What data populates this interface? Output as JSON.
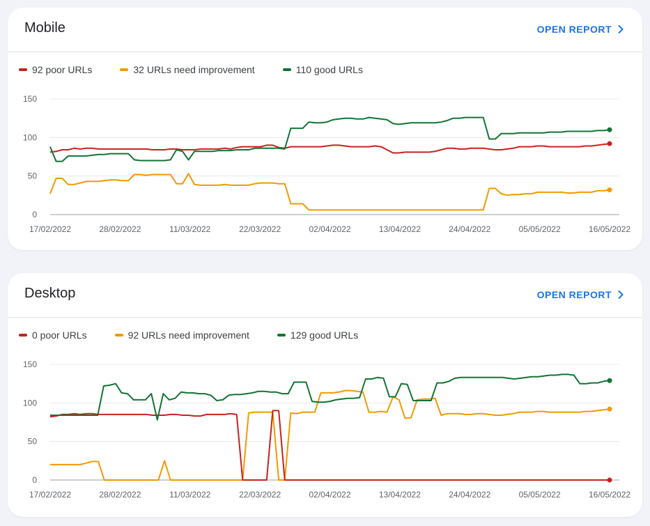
{
  "colors": {
    "poor": "#c5221f",
    "needs": "#f29900",
    "good": "#137333"
  },
  "cards": [
    {
      "title": "Mobile",
      "open_report_label": "OPEN REPORT",
      "legend": {
        "poor": "92 poor URLs",
        "needs": "32 URLs need improvement",
        "good": "110 good URLs"
      }
    },
    {
      "title": "Desktop",
      "open_report_label": "OPEN REPORT",
      "legend": {
        "poor": "0 poor URLs",
        "needs": "92 URLs need improvement",
        "good": "129 good URLs"
      }
    }
  ],
  "chart_data": [
    {
      "type": "line",
      "title": "",
      "y_ticks": [
        "150",
        "100",
        "50",
        "0"
      ],
      "ylim": [
        0,
        150
      ],
      "x_labels": [
        "17/02/2022",
        "28/02/2022",
        "11/03/2022",
        "22/03/2022",
        "02/04/2022",
        "13/04/2022",
        "24/04/2022",
        "05/05/2022",
        "16/05/2022"
      ],
      "x_start": "17/02/2022",
      "x_end": "16/05/2022",
      "series": [
        {
          "name": "92 poor URLs",
          "key": "poor",
          "values": [
            81,
            82,
            84,
            84,
            86,
            85,
            86,
            86,
            85,
            85,
            85,
            85,
            85,
            85,
            85,
            85,
            85,
            84,
            84,
            84,
            85,
            85,
            84,
            84,
            84,
            85,
            85,
            85,
            85,
            86,
            85,
            87,
            88,
            88,
            88,
            88,
            90,
            90,
            87,
            86,
            88,
            88,
            88,
            88,
            88,
            88,
            89,
            90,
            90,
            89,
            88,
            88,
            88,
            88,
            89,
            88,
            84,
            80,
            80,
            81,
            81,
            81,
            81,
            81,
            82,
            84,
            86,
            86,
            85,
            85,
            86,
            86,
            86,
            85,
            84,
            84,
            85,
            86,
            88,
            88,
            88,
            89,
            89,
            88,
            88,
            88,
            88,
            88,
            88,
            89,
            89,
            90,
            91,
            92
          ]
        },
        {
          "name": "32 URLs need improvement",
          "key": "needs",
          "values": [
            27,
            47,
            47,
            39,
            39,
            41,
            43,
            43,
            43,
            44,
            45,
            45,
            44,
            44,
            52,
            52,
            51,
            52,
            52,
            52,
            52,
            40,
            40,
            53,
            39,
            38,
            38,
            38,
            38,
            39,
            38,
            38,
            38,
            38,
            40,
            41,
            41,
            41,
            40,
            40,
            14,
            14,
            14,
            6,
            6,
            6,
            6,
            6,
            6,
            6,
            6,
            6,
            6,
            6,
            6,
            6,
            6,
            6,
            6,
            6,
            6,
            6,
            6,
            6,
            6,
            6,
            6,
            6,
            6,
            6,
            6,
            6,
            6,
            34,
            34,
            27,
            25,
            26,
            26,
            27,
            27,
            29,
            29,
            29,
            29,
            29,
            28,
            28,
            29,
            29,
            29,
            31,
            31,
            32
          ]
        },
        {
          "name": "110 good URLs",
          "key": "good",
          "values": [
            88,
            69,
            69,
            76,
            76,
            76,
            76,
            77,
            78,
            78,
            79,
            79,
            79,
            79,
            71,
            70,
            70,
            70,
            70,
            70,
            71,
            84,
            82,
            71,
            82,
            82,
            82,
            82,
            83,
            83,
            83,
            84,
            84,
            84,
            86,
            86,
            86,
            86,
            86,
            85,
            112,
            112,
            112,
            120,
            119,
            119,
            120,
            123,
            124,
            125,
            125,
            124,
            124,
            126,
            125,
            124,
            123,
            118,
            117,
            118,
            119,
            119,
            119,
            119,
            119,
            120,
            122,
            125,
            125,
            126,
            126,
            126,
            126,
            98,
            98,
            105,
            105,
            105,
            106,
            106,
            106,
            106,
            106,
            107,
            107,
            107,
            108,
            108,
            108,
            108,
            108,
            109,
            109,
            110
          ]
        }
      ]
    },
    {
      "type": "line",
      "title": "",
      "y_ticks": [
        "150",
        "100",
        "50",
        "0"
      ],
      "ylim": [
        0,
        150
      ],
      "x_labels": [
        "17/02/2022",
        "28/02/2022",
        "11/03/2022",
        "22/03/2022",
        "02/04/2022",
        "13/04/2022",
        "24/04/2022",
        "05/05/2022",
        "16/05/2022"
      ],
      "x_start": "17/02/2022",
      "x_end": "16/05/2022",
      "series": [
        {
          "name": "0 poor URLs",
          "key": "poor",
          "values": [
            82,
            83,
            85,
            85,
            86,
            85,
            86,
            86,
            85,
            85,
            85,
            85,
            85,
            85,
            85,
            85,
            85,
            84,
            84,
            84,
            85,
            85,
            84,
            84,
            83,
            83,
            85,
            85,
            85,
            85,
            86,
            85,
            0,
            0,
            0,
            0,
            0,
            90,
            90,
            0,
            0,
            0,
            0,
            0,
            0,
            0,
            0,
            0,
            0,
            0,
            0,
            0,
            0,
            0,
            0,
            0,
            0,
            0,
            0,
            0,
            0,
            0,
            0,
            0,
            0,
            0,
            0,
            0,
            0,
            0,
            0,
            0,
            0,
            0,
            0,
            0,
            0,
            0,
            0,
            0,
            0,
            0,
            0,
            0,
            0,
            0,
            0,
            0,
            0,
            0,
            0,
            0,
            0,
            0
          ]
        },
        {
          "name": "92 URLs need improvement",
          "key": "needs",
          "values": [
            20,
            20,
            20,
            20,
            20,
            20,
            22,
            24,
            24,
            0,
            0,
            0,
            0,
            0,
            0,
            0,
            0,
            0,
            0,
            25,
            0,
            0,
            0,
            0,
            0,
            0,
            0,
            0,
            0,
            0,
            0,
            0,
            0,
            87,
            88,
            88,
            88,
            88,
            0,
            0,
            87,
            86,
            88,
            88,
            88,
            113,
            113,
            113,
            114,
            116,
            116,
            115,
            114,
            88,
            88,
            89,
            88,
            108,
            104,
            80,
            81,
            104,
            105,
            105,
            106,
            84,
            86,
            86,
            86,
            85,
            85,
            86,
            86,
            85,
            84,
            84,
            85,
            86,
            88,
            88,
            88,
            89,
            89,
            88,
            88,
            88,
            88,
            88,
            88,
            89,
            89,
            90,
            91,
            92
          ]
        },
        {
          "name": "129 good URLs",
          "key": "good",
          "values": [
            84,
            84,
            84,
            84,
            84,
            84,
            84,
            84,
            84,
            122,
            123,
            125,
            113,
            112,
            104,
            104,
            104,
            112,
            78,
            112,
            104,
            106,
            114,
            113,
            113,
            112,
            112,
            110,
            103,
            104,
            110,
            111,
            111,
            112,
            113,
            115,
            115,
            114,
            114,
            112,
            112,
            127,
            127,
            127,
            102,
            101,
            101,
            102,
            104,
            105,
            106,
            106,
            107,
            131,
            131,
            133,
            132,
            108,
            108,
            125,
            124,
            103,
            103,
            103,
            103,
            126,
            126,
            128,
            132,
            133,
            133,
            133,
            133,
            133,
            133,
            133,
            133,
            132,
            131,
            132,
            133,
            134,
            134,
            135,
            136,
            136,
            137,
            137,
            136,
            125,
            125,
            126,
            126,
            128,
            129
          ]
        }
      ]
    }
  ]
}
